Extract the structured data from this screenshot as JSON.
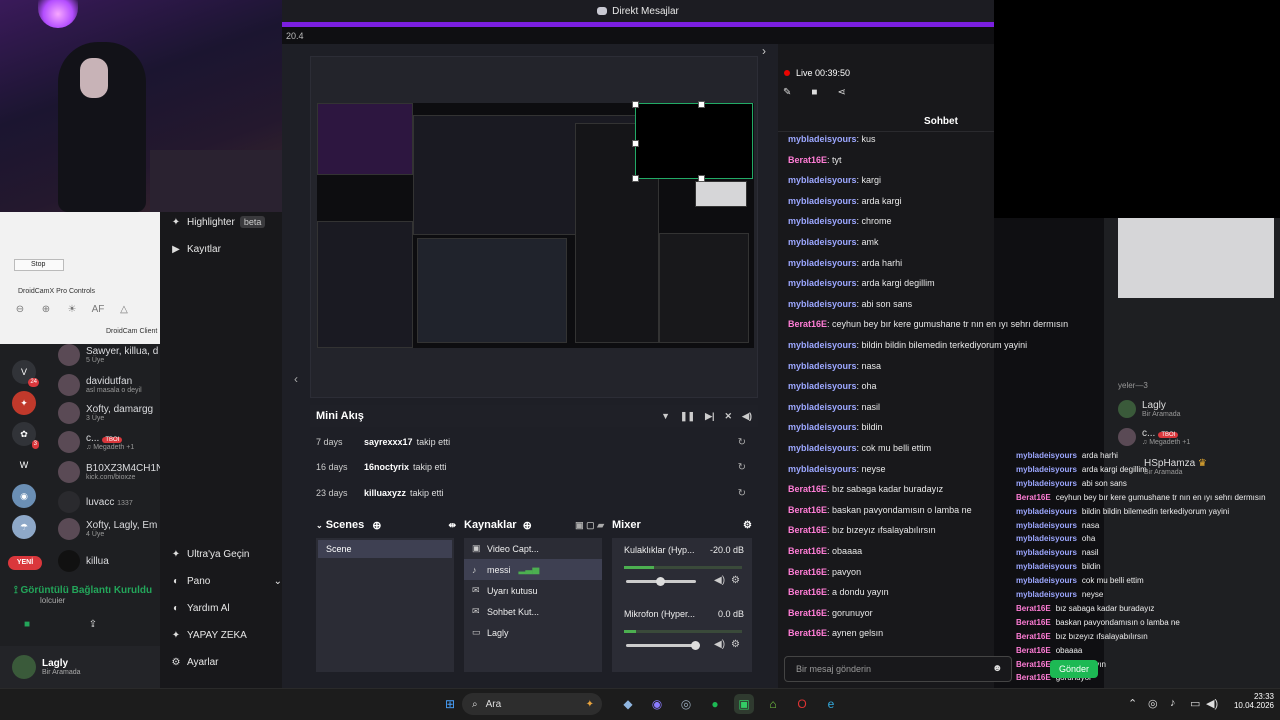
{
  "topbar": {
    "title": "Direkt Mesajlar",
    "version": "20.4"
  },
  "droidcam": {
    "stop": "Stop",
    "controls": "DroidCamX Pro Controls",
    "client": "DroidCam Client",
    "tools": [
      "⊖",
      "⊕",
      "☀",
      "AF",
      "△"
    ]
  },
  "discord": {
    "servers": [
      {
        "label": "V",
        "badge": "24"
      },
      {
        "label": "✦",
        "badge": ""
      },
      {
        "label": "✿",
        "badge": "3"
      },
      {
        "label": "W",
        "badge": ""
      },
      {
        "label": "◉",
        "badge": ""
      },
      {
        "label": "☂",
        "badge": ""
      }
    ],
    "dms": [
      {
        "name": "Sawyer, killua, d",
        "sub": "5 Üye"
      },
      {
        "name": "davidutfan",
        "sub": "asl masala o deyil"
      },
      {
        "name": "Xofty, damargg",
        "sub": "3 Üye"
      },
      {
        "name": "c...",
        "sub": "♫ Megadeth +1",
        "tag": "TBOI"
      },
      {
        "name": "B10XZ3M4CH1N",
        "sub": "kick.com/bioxze"
      },
      {
        "name": "luvacc",
        "sub": "",
        "extra": "1337"
      },
      {
        "name": "Xofty, Lagly, Em",
        "sub": "4 Üye"
      },
      {
        "name": "killua",
        "sub": ""
      }
    ],
    "new_label": "YENİ",
    "voice_title": "Görüntülü Bağlantı Kuruldu",
    "voice_sub": "lolcuier",
    "user": {
      "name": "Lagly",
      "status": "Bir Aramada"
    }
  },
  "twnav": [
    {
      "icon": "✦",
      "label": "Highlighter",
      "badge": "beta"
    },
    {
      "icon": "▶",
      "label": "Kayıtlar"
    },
    {
      "icon": "✦",
      "label": "Ultra'ya Geçin"
    },
    {
      "icon": "◐",
      "label": "Pano",
      "chev": "⌄"
    },
    {
      "icon": "◐",
      "label": "Yardım Al"
    },
    {
      "icon": "✦",
      "label": "YAPAY ZEKA"
    },
    {
      "icon": "⚙",
      "label": "Ayarlar"
    }
  ],
  "mini": {
    "title": "Mini Akış",
    "events": [
      {
        "days": "7 days",
        "user": "sayrexxx17",
        "action": "takip etti"
      },
      {
        "days": "16 days",
        "user": "16noctyrix",
        "action": "takip etti"
      },
      {
        "days": "23 days",
        "user": "killuaxyzz",
        "action": "takip etti"
      }
    ]
  },
  "scenes": {
    "title": "Scenes",
    "items": [
      "Scene"
    ]
  },
  "sources": {
    "title": "Kaynaklar",
    "items": [
      {
        "icon": "▣",
        "label": "Video Capt..."
      },
      {
        "icon": "♪",
        "label": "messi",
        "selected": true
      },
      {
        "icon": "✉",
        "label": "Uyarı kutusu"
      },
      {
        "icon": "✉",
        "label": "Sohbet Kut..."
      },
      {
        "icon": "▭",
        "label": "Lagly"
      }
    ]
  },
  "mixer": {
    "title": "Mixer",
    "channels": [
      {
        "name": "Kulaklıklar (Hyp...",
        "db": "-20.0 dB",
        "level": 0.25,
        "volume": 0.5
      },
      {
        "name": "Mikrofon (Hyper...",
        "db": "0.0 dB",
        "level": 0.1,
        "volume": 1.0
      }
    ]
  },
  "chat": {
    "live": "Live 00:39:50",
    "header": "Sohbet",
    "placeholder": "Bir mesaj gönderin",
    "messages": [
      {
        "user": "mybladeisyours",
        "text": "kus"
      },
      {
        "user": "Berat16E",
        "text": "tyt"
      },
      {
        "user": "mybladeisyours",
        "text": "kargi"
      },
      {
        "user": "mybladeisyours",
        "text": "arda kargi"
      },
      {
        "user": "mybladeisyours",
        "text": "chrome"
      },
      {
        "user": "mybladeisyours",
        "text": "amk"
      },
      {
        "user": "mybladeisyours",
        "text": "arda harhi"
      },
      {
        "user": "mybladeisyours",
        "text": "arda kargi degillim"
      },
      {
        "user": "mybladeisyours",
        "text": "abi son sans"
      },
      {
        "user": "Berat16E",
        "text": "ceyhun bey bır kere gumushane tr nın en ıyı sehrı dermısın"
      },
      {
        "user": "mybladeisyours",
        "text": "bildin bildin bilemedin terkediyorum yayini"
      },
      {
        "user": "mybladeisyours",
        "text": "nasa"
      },
      {
        "user": "mybladeisyours",
        "text": "oha"
      },
      {
        "user": "mybladeisyours",
        "text": "nasil"
      },
      {
        "user": "mybladeisyours",
        "text": "bildin"
      },
      {
        "user": "mybladeisyours",
        "text": "cok mu belli ettim"
      },
      {
        "user": "mybladeisyours",
        "text": "neyse"
      },
      {
        "user": "Berat16E",
        "text": "bız sabaga kadar buradayız"
      },
      {
        "user": "Berat16E",
        "text": "baskan pavyondamısın o lamba ne"
      },
      {
        "user": "Berat16E",
        "text": "bız bızeyız ıfsalayabılırsın"
      },
      {
        "user": "Berat16E",
        "text": "obaaaa"
      },
      {
        "user": "Berat16E",
        "text": "pavyon"
      },
      {
        "user": "Berat16E",
        "text": "a dondu yayın"
      },
      {
        "user": "Berat16E",
        "text": "gorunuyor"
      },
      {
        "user": "Berat16E",
        "text": "aynen gelsın"
      }
    ],
    "send": "Gönder"
  },
  "overlay": {
    "messages": [
      {
        "user": "mybladeisyours",
        "text": "arda harhi"
      },
      {
        "user": "mybladeisyours",
        "text": "arda kargi degillim"
      },
      {
        "user": "mybladeisyours",
        "text": "abi son sans"
      },
      {
        "user": "Berat16E",
        "text": "ceyhun bey bır kere gumushane tr nın en ıyı sehrı dermısın"
      },
      {
        "user": "mybladeisyours",
        "text": "bildin bildin bilemedin terkediyorum yayini"
      },
      {
        "user": "mybladeisyours",
        "text": "nasa"
      },
      {
        "user": "mybladeisyours",
        "text": "oha"
      },
      {
        "user": "mybladeisyours",
        "text": "nasil"
      },
      {
        "user": "mybladeisyours",
        "text": "bildin"
      },
      {
        "user": "mybladeisyours",
        "text": "cok mu belli ettim"
      },
      {
        "user": "mybladeisyours",
        "text": "neyse"
      },
      {
        "user": "Berat16E",
        "text": "bız sabaga kadar buradayız"
      },
      {
        "user": "Berat16E",
        "text": "baskan pavyondamısın o lamba ne"
      },
      {
        "user": "Berat16E",
        "text": "bız bızeyız ıfsalayabılırsın"
      },
      {
        "user": "Berat16E",
        "text": "obaaaa"
      },
      {
        "user": "Berat16E",
        "text": "a dondu yayın"
      },
      {
        "user": "Berat16E",
        "text": "gorunuyor"
      },
      {
        "user": "Berat16E",
        "text": "aynen gelsın"
      }
    ]
  },
  "rightDiscord": {
    "section": "yeler—3",
    "members": [
      {
        "name": "Lagly",
        "sub": "Bir Aramada"
      },
      {
        "name": "c...",
        "sub": "♫ Megadeth +1",
        "tag": "TBOI"
      },
      {
        "name": "HSpHamza",
        "sub": "Bir Aramada"
      }
    ]
  },
  "taskbar": {
    "search": "Ara",
    "time": "23:33",
    "date": "10.04.2026"
  },
  "colors": {
    "accent": "#7b1fe0",
    "live": "#eb0400",
    "chatUser1": "#9ca7ff",
    "chatUser2": "#ff7dd6",
    "send": "#1db954"
  }
}
